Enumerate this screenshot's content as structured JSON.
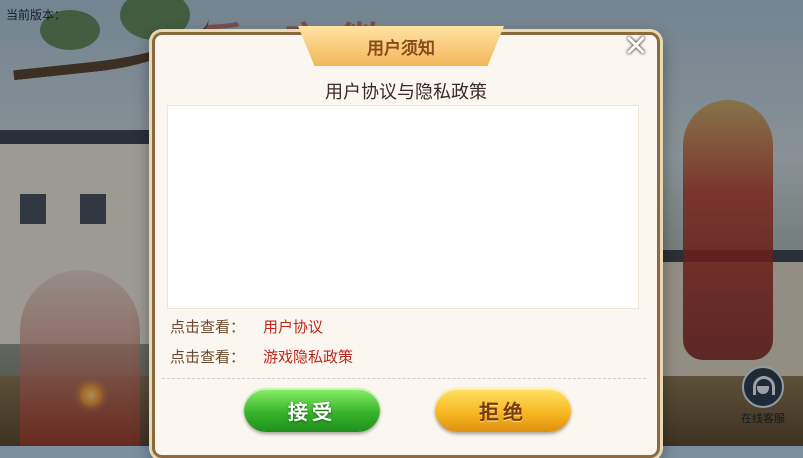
{
  "background": {
    "version_text": "当前版本：",
    "logo_text": "乐 安徽",
    "customer_service_label": "在线客服"
  },
  "dialog": {
    "title": "用户须知",
    "subtitle": "用户协议与隐私政策",
    "close_icon": "close-icon",
    "link_prefix": "点击查看：",
    "links": [
      {
        "label": "用户协议"
      },
      {
        "label": "游戏隐私政策"
      }
    ],
    "accept_label": "接受",
    "reject_label": "拒绝"
  },
  "colors": {
    "accent_green": "#37b52b",
    "accent_yellow": "#f7b823",
    "link_red": "#c0281e",
    "title_brown": "#8a4a1a"
  }
}
